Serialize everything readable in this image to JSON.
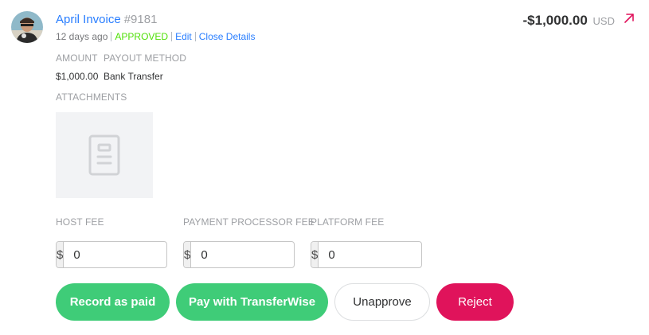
{
  "expense": {
    "title": "April Invoice",
    "number": "#9181",
    "age": "12 days ago",
    "status": "APPROVED",
    "edit_label": "Edit",
    "close_label": "Close Details",
    "total_amount": "-$1,000.00",
    "currency": "USD",
    "amount_label": "AMOUNT",
    "amount_value": "$1,000.00",
    "payout_method_label": "PAYOUT METHOD",
    "payout_method_value": "Bank Transfer",
    "attachments_label": "ATTACHMENTS"
  },
  "fees": [
    {
      "label": "HOST FEE",
      "prefix": "$",
      "value": "0"
    },
    {
      "label": "PAYMENT PROCESSOR FEE",
      "prefix": "$",
      "value": "0"
    },
    {
      "label": "PLATFORM FEE",
      "prefix": "$",
      "value": "0"
    }
  ],
  "actions": {
    "record_paid": "Record as paid",
    "pay_transferwise": "Pay with TransferWise",
    "unapprove": "Unapprove",
    "reject": "Reject"
  },
  "colors": {
    "link": "#297eff",
    "approved": "#51e009",
    "green_button": "#3fcc78",
    "reject_button": "#e0135b",
    "arrow": "#e0135b"
  },
  "icons": {
    "avatar": "user-avatar",
    "arrow": "arrow-up-right-icon",
    "attachment": "document-icon"
  }
}
